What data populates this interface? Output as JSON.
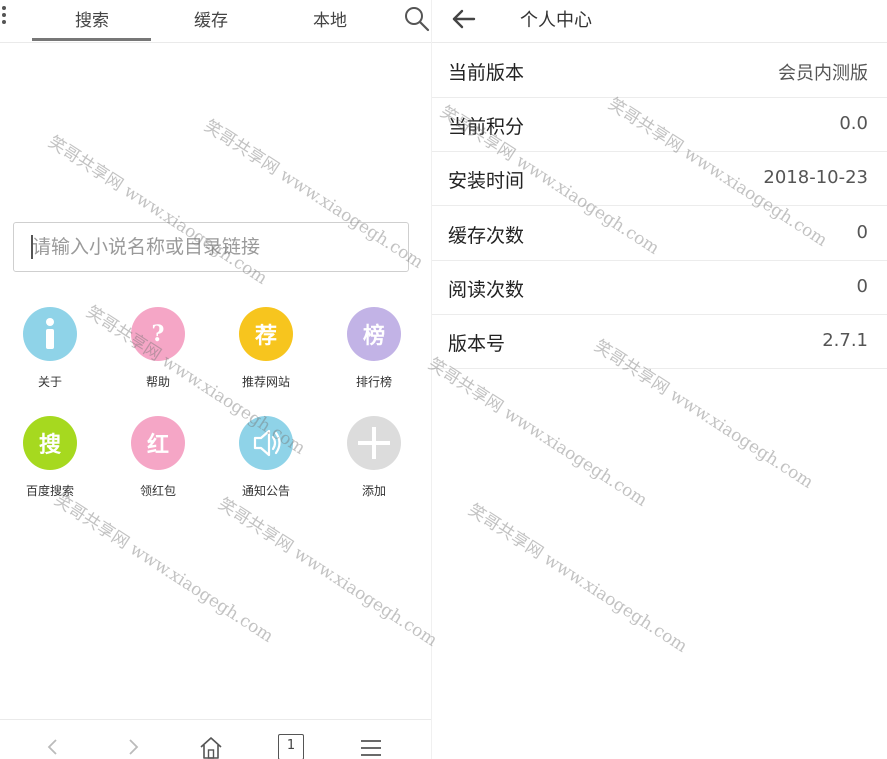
{
  "left": {
    "tabs": [
      {
        "label": "搜索",
        "active": true
      },
      {
        "label": "缓存",
        "active": false
      },
      {
        "label": "本地",
        "active": false
      }
    ],
    "search": {
      "placeholder": "请输入小说名称或目录链接",
      "value": ""
    },
    "grid": [
      {
        "glyph": "i",
        "label": "关于",
        "color": "#8fd3e8",
        "icon": "info-icon"
      },
      {
        "glyph": "?",
        "label": "帮助",
        "color": "#f5a6c6",
        "icon": "question-icon"
      },
      {
        "glyph": "荐",
        "label": "推荐网站",
        "color": "#f7c51e",
        "icon": "recommend-icon"
      },
      {
        "glyph": "榜",
        "label": "排行榜",
        "color": "#c2b3e6",
        "icon": "ranking-icon"
      },
      {
        "glyph": "搜",
        "label": "百度搜索",
        "color": "#a6d91f",
        "icon": "baidu-search-icon"
      },
      {
        "glyph": "红",
        "label": "领红包",
        "color": "#f5a6c6",
        "icon": "red-envelope-icon"
      },
      {
        "glyph": "",
        "label": "通知公告",
        "color": "#8fd3e8",
        "icon": "speaker-icon"
      },
      {
        "glyph": "",
        "label": "添加",
        "color": "#dcdcdc",
        "icon": "plus-icon"
      }
    ],
    "page_count": "1"
  },
  "right": {
    "title": "个人中心",
    "rows": [
      {
        "key": "当前版本",
        "value": "会员内测版"
      },
      {
        "key": "当前积分",
        "value": "0.0"
      },
      {
        "key": "安装时间",
        "value": "2018-10-23"
      },
      {
        "key": "缓存次数",
        "value": "0"
      },
      {
        "key": "阅读次数",
        "value": "0"
      },
      {
        "key": "版本号",
        "value": "2.7.1"
      }
    ]
  },
  "watermark": "笑哥共享网 www.xiaogegh.com"
}
